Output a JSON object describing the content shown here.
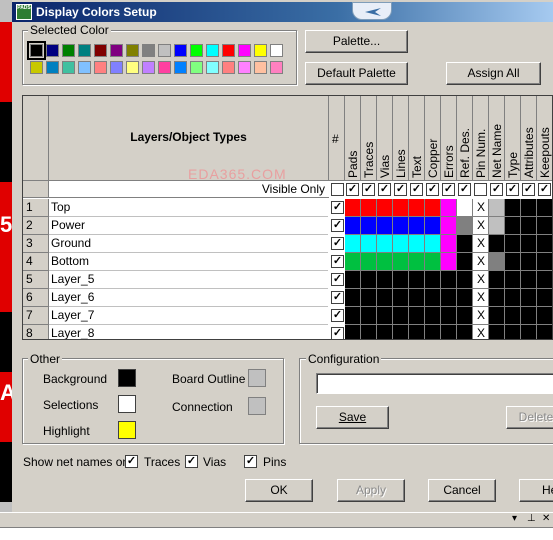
{
  "window": {
    "title": "Display Colors Setup",
    "icon_label": "PADS"
  },
  "background_app": {
    "left_chars": [
      "5",
      "A"
    ]
  },
  "selected_color": {
    "label": "Selected Color",
    "palette": [
      [
        "#000000",
        "#000080",
        "#008000",
        "#008080",
        "#800000",
        "#800080",
        "#808000",
        "#808080",
        "#c0c0c0",
        "#0000ff",
        "#00ff00",
        "#00ffff",
        "#ff0000",
        "#ff00ff",
        "#ffff00",
        "#ffffff"
      ],
      [
        "#c8c800",
        "#0080c0",
        "#40c0a0",
        "#80c0ff",
        "#ff8080",
        "#8080ff",
        "#ffff80",
        "#c080ff",
        "#ff40a0",
        "#0080ff",
        "#80ff80",
        "#80ffff",
        "#ff8080",
        "#ff80ff",
        "#ffc0a0",
        "#ff80c0"
      ]
    ]
  },
  "buttons": {
    "palette": "Palette...",
    "default_palette": "Default Palette",
    "assign_all": "Assign All",
    "ok": "OK",
    "apply": "Apply",
    "cancel": "Cancel",
    "help": "He",
    "save": "Save",
    "delete": "Delete"
  },
  "grid": {
    "header": "Layers/Object Types",
    "hash": "#",
    "visible_only": "Visible Only",
    "columns": [
      "Pads",
      "Traces",
      "Vias",
      "Lines",
      "Text",
      "Copper",
      "Errors",
      "Ref. Des.",
      "Pin Num.",
      "Net Name",
      "Type",
      "Attributes",
      "Keepouts"
    ],
    "rows": [
      {
        "num": "1",
        "name": "Top",
        "colors": [
          "#ff0000",
          "#ff0000",
          "#ff0000",
          "#ff0000",
          "#ff0000",
          "#ff0000",
          "#ff00ff",
          "#ffffff",
          "#ffffff",
          "#c0c0c0",
          "#000000",
          "#000000",
          "#000000"
        ]
      },
      {
        "num": "2",
        "name": "Power",
        "colors": [
          "#0000ff",
          "#0000ff",
          "#0000ff",
          "#0000ff",
          "#0000ff",
          "#0000ff",
          "#ff00ff",
          "#808080",
          "#ffffff",
          "#c0c0c0",
          "#000000",
          "#000000",
          "#000000"
        ]
      },
      {
        "num": "3",
        "name": "Ground",
        "colors": [
          "#00ffff",
          "#00ffff",
          "#00ffff",
          "#00ffff",
          "#00ffff",
          "#00ffff",
          "#ff00ff",
          "#000000",
          "#ffffff",
          "#000000",
          "#000000",
          "#000000",
          "#000000"
        ]
      },
      {
        "num": "4",
        "name": "Bottom",
        "colors": [
          "#00c040",
          "#00c040",
          "#00c040",
          "#00c040",
          "#00c040",
          "#00c040",
          "#ff00ff",
          "#000000",
          "#ffffff",
          "#808080",
          "#000000",
          "#000000",
          "#000000"
        ]
      },
      {
        "num": "5",
        "name": "Layer_5",
        "colors": [
          "#000000",
          "#000000",
          "#000000",
          "#000000",
          "#000000",
          "#000000",
          "#000000",
          "#000000",
          "#ffffff",
          "#000000",
          "#000000",
          "#000000",
          "#000000"
        ]
      },
      {
        "num": "6",
        "name": "Layer_6",
        "colors": [
          "#000000",
          "#000000",
          "#000000",
          "#000000",
          "#000000",
          "#000000",
          "#000000",
          "#000000",
          "#ffffff",
          "#000000",
          "#000000",
          "#000000",
          "#000000"
        ]
      },
      {
        "num": "7",
        "name": "Layer_7",
        "colors": [
          "#000000",
          "#000000",
          "#000000",
          "#000000",
          "#000000",
          "#000000",
          "#000000",
          "#000000",
          "#ffffff",
          "#000000",
          "#000000",
          "#000000",
          "#000000"
        ]
      },
      {
        "num": "8",
        "name": "Layer_8",
        "colors": [
          "#000000",
          "#000000",
          "#000000",
          "#000000",
          "#000000",
          "#000000",
          "#000000",
          "#000000",
          "#ffffff",
          "#000000",
          "#000000",
          "#000000",
          "#000000"
        ]
      }
    ],
    "x_mark": "X",
    "watermark": "EDA365.COM"
  },
  "other": {
    "label": "Other",
    "background": {
      "label": "Background",
      "color": "#000000"
    },
    "selections": {
      "label": "Selections",
      "color": "#ffffff"
    },
    "highlight": {
      "label": "Highlight",
      "color": "#ffff00"
    },
    "board_outline": {
      "label": "Board Outline",
      "color": "#c0c0c0"
    },
    "connection": {
      "label": "Connection",
      "color": "#c0c0c0"
    }
  },
  "configuration": {
    "label": "Configuration",
    "value": ""
  },
  "show_net_names": {
    "label": "Show net names on",
    "traces": "Traces",
    "vias": "Vias",
    "pins": "Pins"
  }
}
